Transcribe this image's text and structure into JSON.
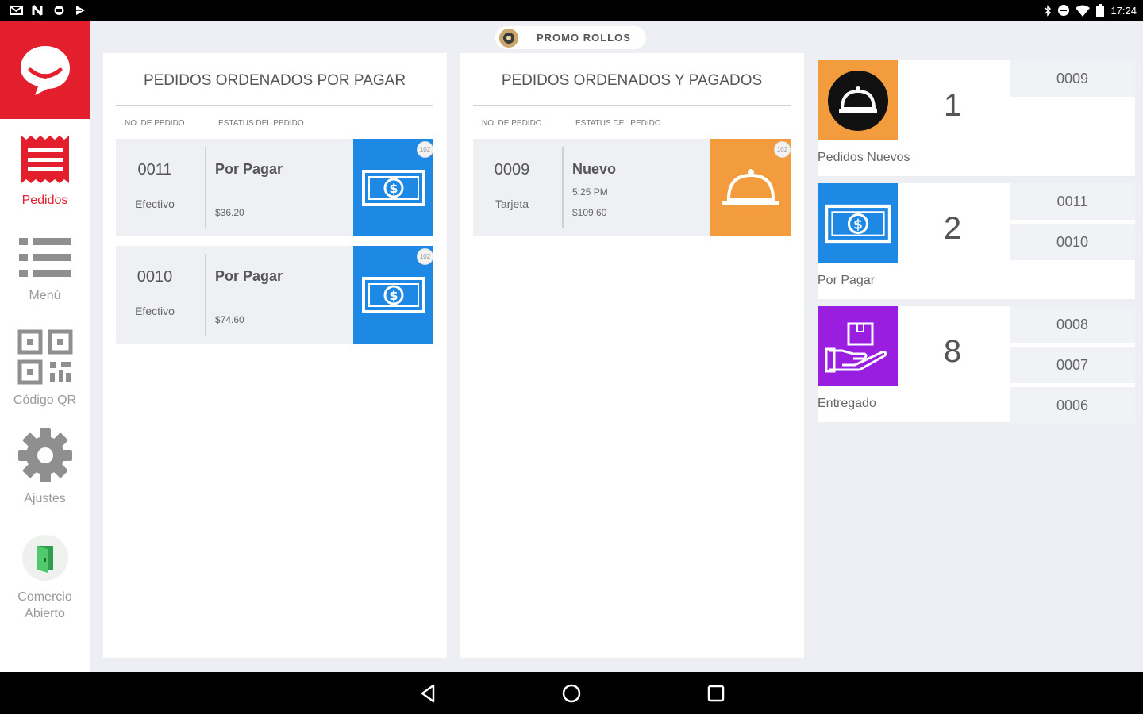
{
  "status_bar": {
    "time": "17:24",
    "left_icons": [
      "gmail-icon",
      "netflix-icon",
      "messages-icon",
      "play-store-icon"
    ],
    "right_icons": [
      "bluetooth-icon",
      "dnd-icon",
      "wifi-icon",
      "battery-icon"
    ]
  },
  "sidebar": {
    "logo_icon": "chat-bubble-logo-icon",
    "items": [
      {
        "label": "Pedidos",
        "icon": "receipt-icon",
        "active": true
      },
      {
        "label": "Menú",
        "icon": "list-icon",
        "active": false
      },
      {
        "label": "Código QR",
        "icon": "qr-code-icon",
        "active": false
      },
      {
        "label": "Ajustes",
        "icon": "gear-icon",
        "active": false
      },
      {
        "label": "Comercio Abierto",
        "icon": "open-door-icon",
        "active": false
      }
    ]
  },
  "store": {
    "name": "PROMO ROLLOS"
  },
  "columns": [
    {
      "title": "PEDIDOS ORDENADOS POR PAGAR",
      "head_number": "No. DE PEDIDO",
      "head_status": "ESTATUS DEL PEDIDO",
      "orders": [
        {
          "number": "0011",
          "payment": "Efectivo",
          "status": "Por Pagar",
          "time": "",
          "amount": "$36.20",
          "icon": "cash-icon",
          "color": "#1e88e5"
        },
        {
          "number": "0010",
          "payment": "Efectivo",
          "status": "Por Pagar",
          "time": "",
          "amount": "$74.60",
          "icon": "cash-icon",
          "color": "#1e88e5"
        }
      ]
    },
    {
      "title": "PEDIDOS ORDENADOS Y PAGADOS",
      "head_number": "No. DE PEDIDO",
      "head_status": "ESTATUS DEL PEDIDO",
      "orders": [
        {
          "number": "0009",
          "payment": "Tarjeta",
          "status": "Nuevo",
          "time": "5:25 PM",
          "amount": "$109.60",
          "icon": "cloche-icon",
          "color": "#f39c3d"
        }
      ]
    }
  ],
  "summary": [
    {
      "label": "Pedidos Nuevos",
      "count": "1",
      "icon": "cloche-icon",
      "color": "#f39c3d",
      "ids": [
        "0009"
      ]
    },
    {
      "label": "Por Pagar",
      "count": "2",
      "icon": "cash-icon",
      "color": "#1e88e5",
      "ids": [
        "0011",
        "0010"
      ]
    },
    {
      "label": "Entregado",
      "count": "8",
      "icon": "delivered-package-icon",
      "color": "#9a1ee0",
      "ids": [
        "0008",
        "0007",
        "0006"
      ]
    }
  ],
  "navbar": {
    "buttons": [
      "back-icon",
      "home-icon",
      "recents-icon"
    ]
  }
}
